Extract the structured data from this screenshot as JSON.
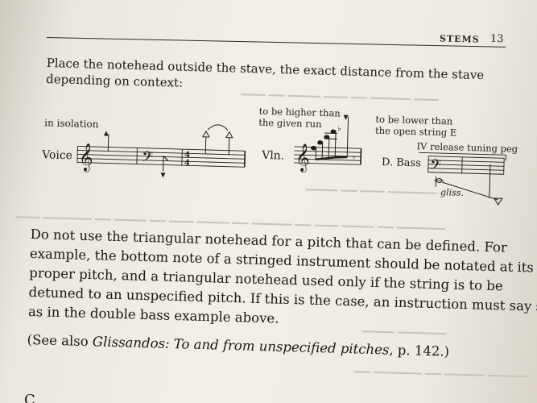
{
  "header": {
    "running_head": "STEMS",
    "page_number": "13"
  },
  "para1": {
    "line1": "Place the notehead outside the stave, the exact distance from the stave",
    "line2": "depending on context:"
  },
  "example": {
    "in_isolation": "in isolation",
    "voice_label": "Voice",
    "higher_line1": "to be higher than",
    "higher_line2": "the given run",
    "vln_label": "Vln.",
    "lower_line1": "to be lower than",
    "lower_line2": "the open string E",
    "dbass_label": "D. Bass",
    "tuning_peg": "IV release tuning peg",
    "gliss": "gliss."
  },
  "para2": {
    "line1": "Do not use the triangular notehead for a pitch that can be defined. For",
    "line2": "example, the bottom note of a stringed instrument should be notated at its",
    "line3": "proper pitch, and a triangular notehead used only if the string is to be",
    "line4": "detuned to an unspecified pitch. If this is the case, an instruction must say so,",
    "line5": "as in the double bass example above."
  },
  "para3": {
    "prefix": "(See also ",
    "italic": "Glissandos: To and from unspecified pitches",
    "suffix": ", p. 142.)"
  },
  "colors": {
    "ink": "#1f1d1a",
    "paper": "#f2efe7",
    "bleed_through": "#c9c4ba"
  }
}
